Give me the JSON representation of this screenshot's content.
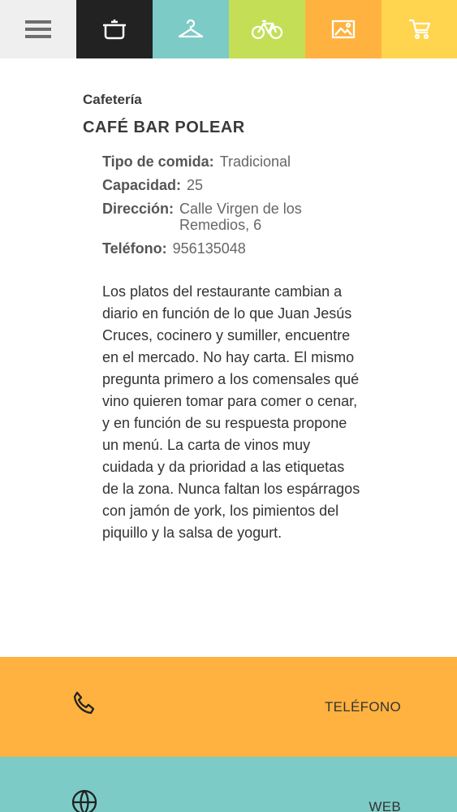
{
  "nav": {
    "tabs": [
      {
        "icon": "menu-icon",
        "color": "#efefef"
      },
      {
        "icon": "cooking-pot-icon",
        "color": "#222222"
      },
      {
        "icon": "hanger-icon",
        "color": "#7ccbc6"
      },
      {
        "icon": "bicycle-icon",
        "color": "#c4df55"
      },
      {
        "icon": "image-icon",
        "color": "#ffb23f"
      },
      {
        "icon": "cart-icon",
        "color": "#ffd54f"
      }
    ]
  },
  "place": {
    "category": "Cafetería",
    "name": "CAFÉ BAR POLEAR",
    "details": {
      "food_label": "Tipo de comida:",
      "food_value": "Tradicional",
      "capacity_label": "Capacidad:",
      "capacity_value": "25",
      "address_label": "Dirección:",
      "address_value": "Calle Virgen de los Remedios, 6",
      "phone_label": "Teléfono:",
      "phone_value": "956135048"
    },
    "description": "Los platos del restaurante cambian a diario en función de lo que Juan Jesús Cruces, cocinero y sumiller, encuentre en el mercado. No hay carta. El mismo pregunta primero a los comensales qué vino quieren tomar para comer o cenar, y en función de su respuesta propone un menú. La carta de vinos muy cuidada y da prioridad a las etiquetas de la zona. Nunca faltan los espárragos con jamón de york, los pimientos del piquillo y la salsa de yogurt."
  },
  "actions": {
    "phone_label": "TELÉFONO",
    "phone_color": "#ffb23f",
    "web_label": "WEB",
    "web_color": "#7ccbc6"
  }
}
